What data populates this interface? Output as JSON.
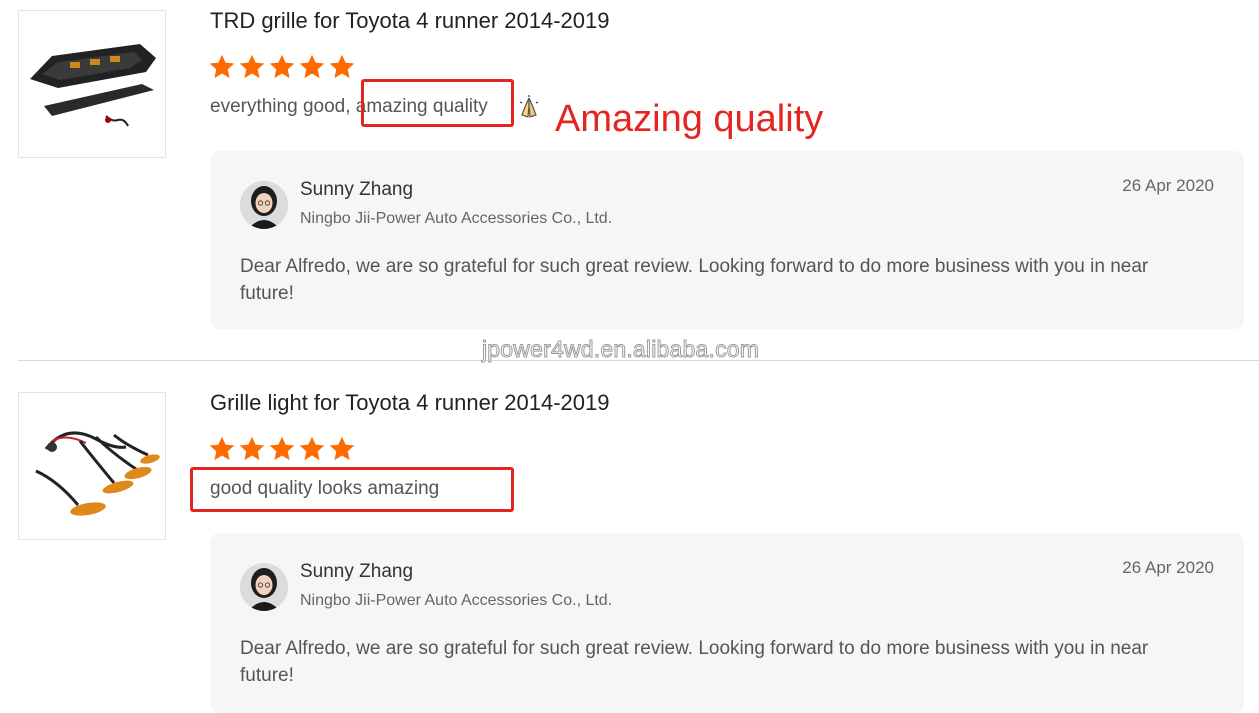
{
  "reviews": [
    {
      "product_title": "TRD grille for Toyota 4 runner 2014-2019",
      "rating": 5,
      "comment_prefix": "everything good,",
      "comment_highlight": "amazing quality",
      "reply": {
        "name": "Sunny Zhang",
        "company": "Ningbo Jii-Power Auto Accessories Co., Ltd.",
        "date": "26 Apr 2020",
        "text": "Dear Alfredo,  we are so grateful for such great review. Looking forward to do more business with you in near future!"
      }
    },
    {
      "product_title": "Grille light for Toyota 4 runner 2014-2019",
      "rating": 5,
      "comment": "good quality looks amazing",
      "reply": {
        "name": "Sunny Zhang",
        "company": "Ningbo Jii-Power Auto Accessories Co., Ltd.",
        "date": "26 Apr 2020",
        "text": "Dear Alfredo,  we are so grateful for such great review. Looking forward to do more business with you in near future!"
      }
    }
  ],
  "annotation_text": "Amazing quality",
  "watermark": "jpower4wd.en.alibaba.com",
  "colors": {
    "star": "#ff6a00",
    "highlight": "#e3261f",
    "reply_bg": "#f5f6f8"
  }
}
